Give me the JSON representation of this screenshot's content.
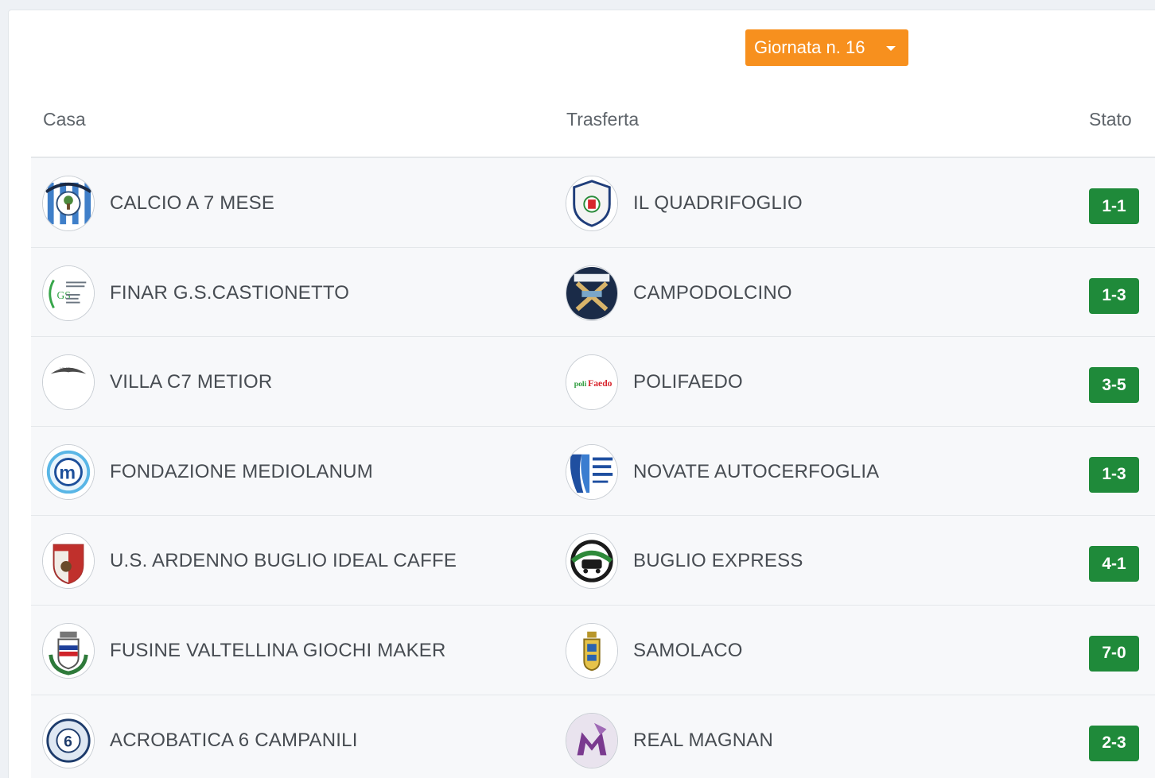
{
  "round_selector": {
    "label": "Giornata n. 16",
    "accent": "#f7901e"
  },
  "headers": {
    "home": "Casa",
    "away": "Trasferta",
    "status": "Stato"
  },
  "score_color": "#1f8a3a",
  "matches": [
    {
      "home": "CALCIO A 7 MESE",
      "home_logo": "striped-shield-logo",
      "away": "IL QUADRIFOGLIO",
      "away_logo": "crest-shield-logo",
      "score": "1-1"
    },
    {
      "home": "FINAR G.S.CASTIONETTO",
      "home_logo": "gs-castionetto-logo",
      "away": "CAMPODOLCINO",
      "away_logo": "crossed-skis-logo",
      "score": "1-3"
    },
    {
      "home": "VILLA C7 METIOR",
      "home_logo": "wing-badge-logo",
      "away": "POLIFAEDO",
      "away_logo": "text-wordmark-logo",
      "score": "3-5"
    },
    {
      "home": "FONDAZIONE MEDIOLANUM",
      "home_logo": "m-circle-logo",
      "away": "NOVATE AUTOCERFOGLIA",
      "away_logo": "csi-logo",
      "score": "1-3"
    },
    {
      "home": "U.S. ARDENNO BUGLIO IDEAL CAFFE",
      "home_logo": "red-shield-logo",
      "away": "BUGLIO EXPRESS",
      "away_logo": "train-badge-logo",
      "score": "4-1"
    },
    {
      "home": "FUSINE VALTELLINA GIOCHI MAKER",
      "home_logo": "municipal-crest-logo",
      "away": "SAMOLACO",
      "away_logo": "tower-crest-logo",
      "score": "7-0"
    },
    {
      "home": "ACROBATICA 6 CAMPANILI",
      "home_logo": "six-bells-logo",
      "away": "REAL MAGNAN",
      "away_logo": "purple-m-logo",
      "score": "2-3"
    }
  ]
}
